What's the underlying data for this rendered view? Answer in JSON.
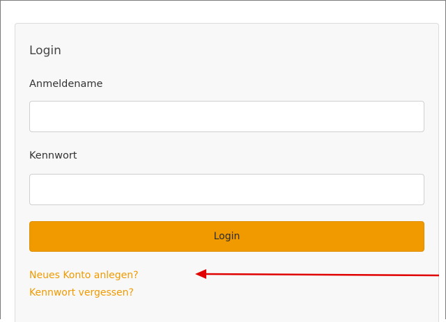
{
  "login_panel": {
    "title": "Login",
    "username_label": "Anmeldename",
    "username_value": "",
    "password_label": "Kennwort",
    "password_value": "",
    "submit_label": "Login",
    "register_link": "Neues Konto anlegen?",
    "forgot_link": "Kennwort vergessen?"
  },
  "colors": {
    "accent": "#f09a00",
    "annotation_arrow": "#e00000"
  },
  "icons": {
    "annotation": "red-arrow-icon"
  }
}
